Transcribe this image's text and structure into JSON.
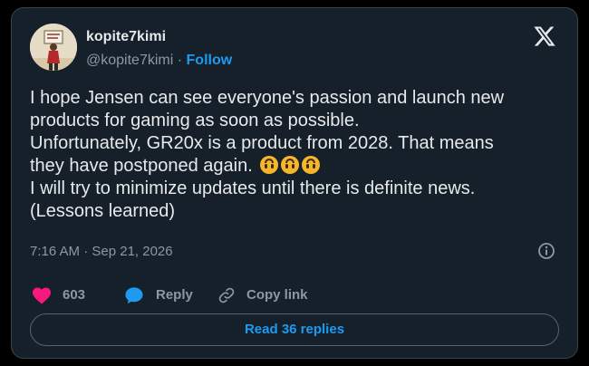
{
  "author": {
    "name": "kopite7kimi",
    "handle": "@kopite7kimi",
    "separator": "·",
    "follow_label": "Follow"
  },
  "tweet": {
    "lines": [
      "I hope Jensen can see everyone's passion and launch new",
      "products for gaming as soon as possible.",
      "Unfortunately, GR20x is a product from 2028. That means",
      "they have postponed again.",
      "I will try to minimize updates until there is definite news.",
      "(Lessons learned)"
    ],
    "emoji": "upside-down-face",
    "emoji_count": 3,
    "timestamp": "7:16 AM · Sep 21, 2026"
  },
  "actions": {
    "like_count": "603",
    "reply_label": "Reply",
    "copy_link_label": "Copy link"
  },
  "read_replies_label": "Read 36 replies",
  "colors": {
    "background": "#15202b",
    "border": "#38444d",
    "text": "#e7e9ea",
    "muted": "#8b98a5",
    "accent": "#1d9bf0",
    "like": "#f91880"
  },
  "icons": [
    "x-logo-icon",
    "info-icon",
    "heart-icon",
    "reply-bubble-icon",
    "link-icon",
    "upside-down-face-emoji"
  ]
}
